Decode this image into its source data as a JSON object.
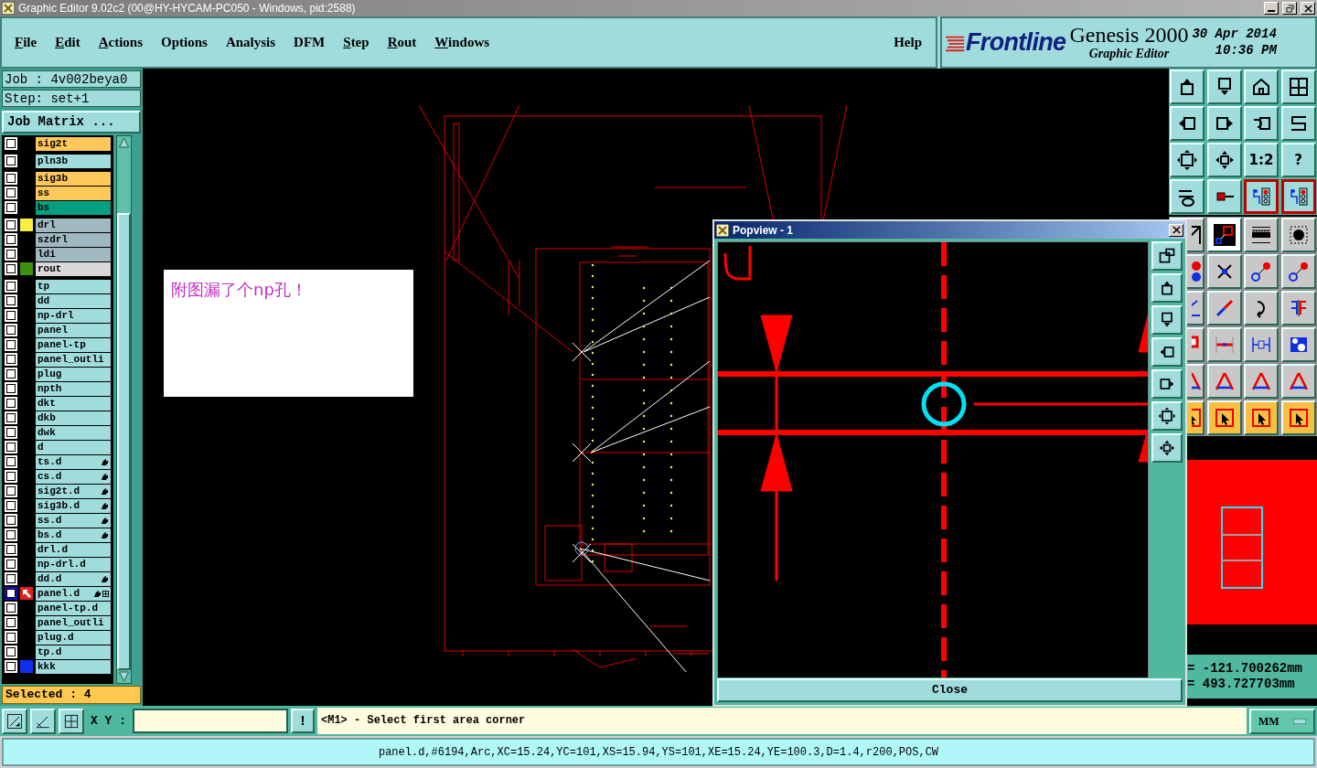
{
  "window": {
    "title": "Graphic Editor 9.02c2 (00@HY-HYCAM-PC050 - Windows, pid:2588)"
  },
  "menu": [
    {
      "label": "File",
      "mnemonic": true
    },
    {
      "label": "Edit",
      "mnemonic": true
    },
    {
      "label": "Actions",
      "mnemonic": true
    },
    {
      "label": "Options",
      "mnemonic": false
    },
    {
      "label": "Analysis",
      "mnemonic": false
    },
    {
      "label": "DFM",
      "mnemonic": false
    },
    {
      "label": "Step",
      "mnemonic": true
    },
    {
      "label": "Rout",
      "mnemonic": true
    },
    {
      "label": "Windows",
      "mnemonic": true
    }
  ],
  "help": "Help",
  "brand": {
    "logo": "Frontline",
    "product": "Genesis 2000",
    "subtitle": "Graphic Editor",
    "date": "30 Apr 2014",
    "time": "10:36 PM"
  },
  "job": "Job : 4v002beya0",
  "step": "Step: set+1",
  "job_matrix": "Job Matrix ...",
  "layer_groups": [
    [
      {
        "name": "sig2t",
        "color": "#ffc85a",
        "selected": false,
        "hand": false
      }
    ],
    [
      {
        "name": "pln3b",
        "color": "#a0dcdc",
        "selected": false,
        "hand": false
      }
    ],
    [
      {
        "name": "sig3b",
        "color": "#ffc85a",
        "selected": false,
        "hand": false
      },
      {
        "name": "ss",
        "color": "#ffc85a",
        "selected": false,
        "hand": false
      },
      {
        "name": "bs",
        "color": "#00a080",
        "selected": false,
        "hand": false
      }
    ],
    [
      {
        "name": "drl",
        "color": "#a0b8c0",
        "selected": false,
        "hand": false,
        "swatch": {
          "kind": "color",
          "color": "#f8f040"
        }
      },
      {
        "name": "szdrl",
        "color": "#a0b8c0",
        "selected": false,
        "hand": false
      },
      {
        "name": "ldi",
        "color": "#a0b8c0",
        "selected": false,
        "hand": false
      },
      {
        "name": "rout",
        "color": "#d8d8d8",
        "selected": false,
        "hand": false,
        "swatch": {
          "kind": "color",
          "color": "#409010"
        }
      }
    ],
    [
      {
        "name": "tp",
        "color": "#a0dcdc",
        "selected": false,
        "hand": false
      },
      {
        "name": "dd",
        "color": "#a0dcdc",
        "selected": false,
        "hand": false
      },
      {
        "name": "np-drl",
        "color": "#a0dcdc",
        "selected": false,
        "hand": false
      },
      {
        "name": "panel",
        "color": "#a0dcdc",
        "selected": false,
        "hand": false
      },
      {
        "name": "panel-tp",
        "color": "#a0dcdc",
        "selected": false,
        "hand": false
      },
      {
        "name": "panel_outli",
        "color": "#a0dcdc",
        "selected": false,
        "hand": false
      },
      {
        "name": "plug",
        "color": "#a0dcdc",
        "selected": false,
        "hand": false
      },
      {
        "name": "npth",
        "color": "#a0dcdc",
        "selected": false,
        "hand": false
      },
      {
        "name": "dkt",
        "color": "#a0dcdc",
        "selected": false,
        "hand": false
      },
      {
        "name": "dkb",
        "color": "#a0dcdc",
        "selected": false,
        "hand": false
      },
      {
        "name": "dwk",
        "color": "#a0dcdc",
        "selected": false,
        "hand": false
      },
      {
        "name": "d",
        "color": "#a0dcdc",
        "selected": false,
        "hand": false
      },
      {
        "name": "ts.d",
        "color": "#a0dcdc",
        "selected": false,
        "hand": true
      },
      {
        "name": "cs.d",
        "color": "#a0dcdc",
        "selected": false,
        "hand": true
      },
      {
        "name": "sig2t.d",
        "color": "#a0dcdc",
        "selected": false,
        "hand": true
      },
      {
        "name": "sig3b.d",
        "color": "#a0dcdc",
        "selected": false,
        "hand": true
      },
      {
        "name": "ss.d",
        "color": "#a0dcdc",
        "selected": false,
        "hand": true
      },
      {
        "name": "bs.d",
        "color": "#a0dcdc",
        "selected": false,
        "hand": true
      },
      {
        "name": "drl.d",
        "color": "#a0dcdc",
        "selected": false,
        "hand": false
      },
      {
        "name": "np-drl.d",
        "color": "#a0dcdc",
        "selected": false,
        "hand": false
      },
      {
        "name": "dd.d",
        "color": "#a0dcdc",
        "selected": false,
        "hand": true
      },
      {
        "name": "panel.d",
        "color": "#a0dcdc",
        "selected": true,
        "hand": true,
        "swatch": {
          "kind": "arrow"
        }
      },
      {
        "name": "panel-tp.d",
        "color": "#a0dcdc",
        "selected": false,
        "hand": false
      },
      {
        "name": "panel_outli",
        "color": "#a0dcdc",
        "selected": false,
        "hand": false
      },
      {
        "name": "plug.d",
        "color": "#a0dcdc",
        "selected": false,
        "hand": false
      },
      {
        "name": "tp.d",
        "color": "#a0dcdc",
        "selected": false,
        "hand": false
      },
      {
        "name": "kkk",
        "color": "#a0dcdc",
        "selected": false,
        "hand": false,
        "swatch": {
          "kind": "color",
          "color": "#1030f0"
        }
      }
    ]
  ],
  "shown": false,
  "selected_count": "Selected : 4",
  "note": {
    "text": "附图漏了个np孔！"
  },
  "view_tools": [
    {
      "kind": "frame-up"
    },
    {
      "kind": "frame-down"
    },
    {
      "kind": "house"
    },
    {
      "kind": "grid-window"
    },
    {
      "kind": "frame-left"
    },
    {
      "kind": "frame-right"
    },
    {
      "kind": "undo"
    },
    {
      "kind": "s-curve"
    },
    {
      "kind": "fit"
    },
    {
      "kind": "fit-small"
    },
    {
      "kind": "text",
      "label": "1:2"
    },
    {
      "kind": "text",
      "label": "?"
    },
    {
      "kind": "tools"
    },
    {
      "kind": "probe"
    },
    {
      "kind": "circuit"
    },
    {
      "kind": "circuit"
    }
  ],
  "edit_tools": [
    {
      "kind": "snap"
    },
    {
      "kind": "select-line"
    },
    {
      "kind": "ruler"
    },
    {
      "kind": "dot"
    },
    {
      "kind": "dots"
    },
    {
      "kind": "cross"
    },
    {
      "kind": "arc-dots"
    },
    {
      "kind": "arc-dots"
    },
    {
      "kind": "line-blue"
    },
    {
      "kind": "line-diag"
    },
    {
      "kind": "rotate"
    },
    {
      "kind": "mirror"
    },
    {
      "kind": "square-red"
    },
    {
      "kind": "line-red"
    },
    {
      "kind": "dimension"
    },
    {
      "kind": "shapes-blue"
    },
    {
      "kind": "triangle"
    },
    {
      "kind": "triangle"
    },
    {
      "kind": "triangle"
    },
    {
      "kind": "triangle"
    },
    {
      "kind": "cursor"
    },
    {
      "kind": "cursor"
    },
    {
      "kind": "cursor"
    },
    {
      "kind": "cursor"
    }
  ],
  "coords": {
    "x": "= -121.700262mm",
    "y": "= 493.727703mm"
  },
  "popview": {
    "title": "Popview - 1",
    "close": "Close",
    "tools": [
      {
        "kind": "window-out"
      },
      {
        "kind": "frame-up"
      },
      {
        "kind": "frame-down"
      },
      {
        "kind": "frame-left"
      },
      {
        "kind": "frame-right"
      },
      {
        "kind": "fit"
      },
      {
        "kind": "fit-small"
      }
    ]
  },
  "bottom_tools": [
    {
      "kind": "zoom-area"
    },
    {
      "kind": "measure"
    },
    {
      "kind": "snap-grid"
    }
  ],
  "xy_label": "X Y :",
  "bang": "!",
  "prompt": "<M1> - Select first area corner",
  "units": "MM",
  "status": "panel.d,#6194,Arc,XC=15.24,YC=101,XS=15.94,YS=101,XE=15.24,YE=100.3,D=1.4,r200,POS,CW"
}
